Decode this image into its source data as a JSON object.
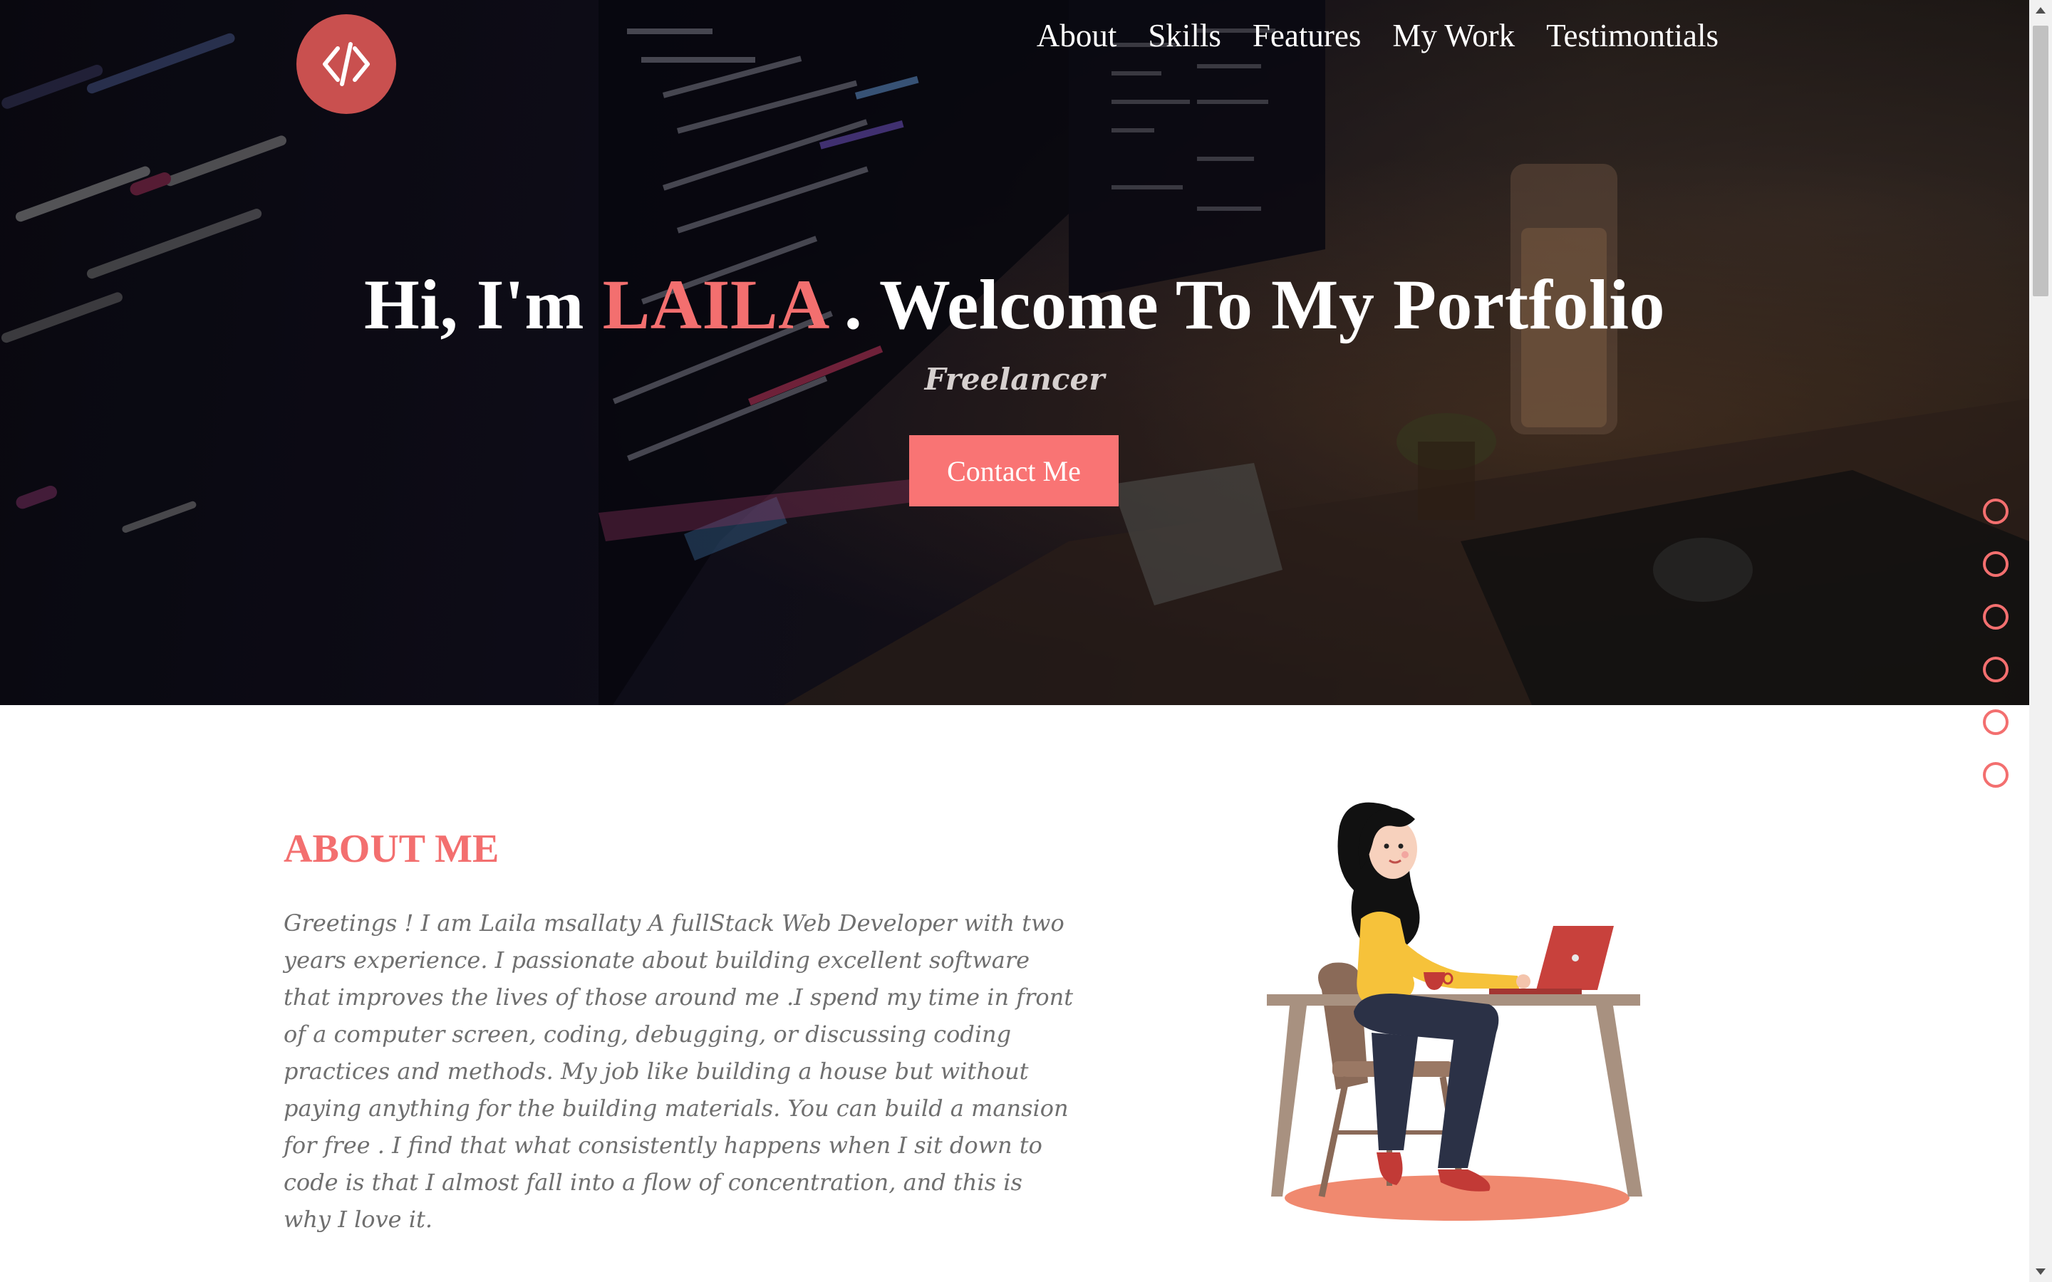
{
  "nav": {
    "logo_icon": "code-brackets-icon",
    "items": [
      "About",
      "Skills",
      "Features",
      "My Work",
      "Testimontials"
    ]
  },
  "hero": {
    "title_pre": "Hi, I'm ",
    "title_name": "LAILA",
    "title_post": " . Welcome To My Portfolio",
    "subtitle": "Freelancer",
    "contact_label": "Contact Me"
  },
  "side_nav": {
    "dot_count": 6
  },
  "about": {
    "title": "ABOUT ME",
    "text": "Greetings ! I am Laila msallaty A fullStack Web Developer with two years experience. I passionate about building excellent software that improves the lives of those around me .I spend my time in front of a computer screen, coding, debugging, or discussing coding practices and methods. My job like building a house but without paying anything for the building materials. You can build a mansion for free . I find that what consistently happens when I sit down to code is that I almost fall into a flow of concentration, and this is why I love it.",
    "illustration": "woman-working-on-laptop-illustration"
  },
  "colors": {
    "accent": "#f36f6f",
    "button": "#f97474",
    "logo_bg": "#c9504f",
    "about_text": "#6f6f6f"
  }
}
